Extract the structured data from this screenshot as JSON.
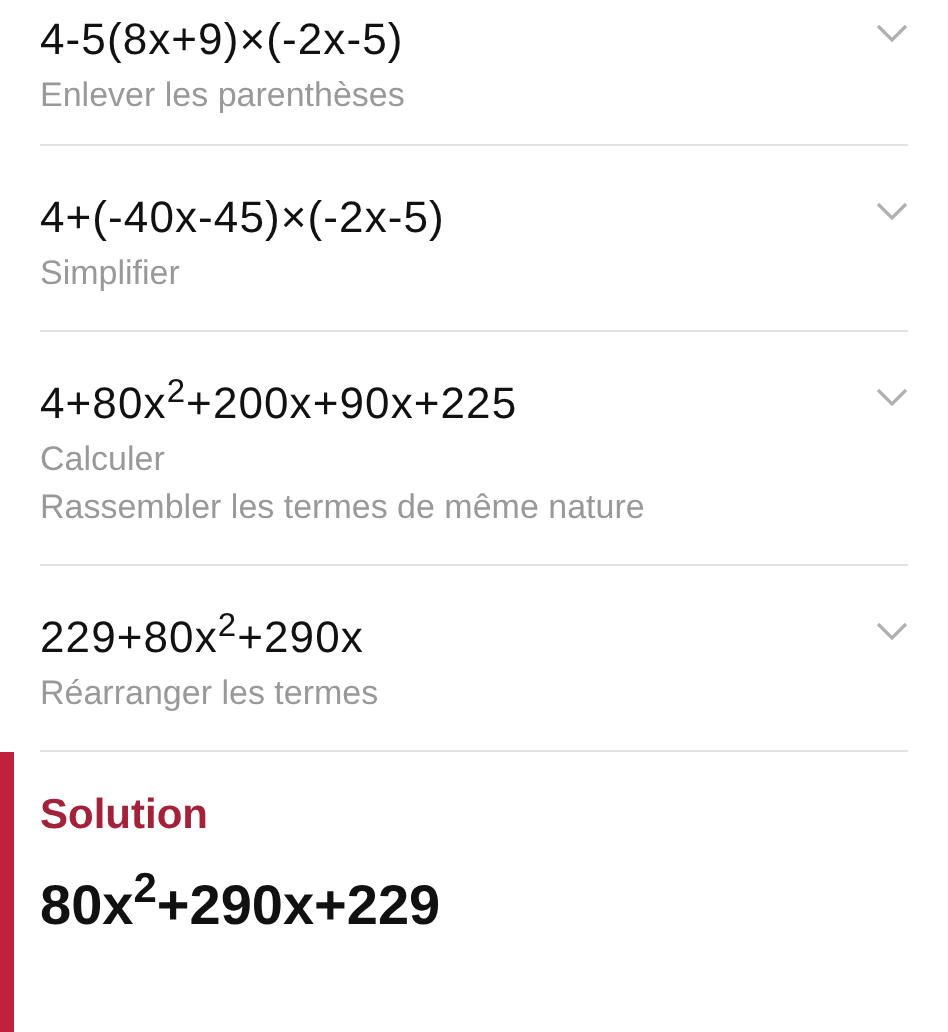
{
  "steps": [
    {
      "expression": "4-5(8x+9)×(-2x-5)",
      "descriptions": [
        "Enlever les parenthèses"
      ],
      "expanded": false
    },
    {
      "expression": "4+(-40x-45)×(-2x-5)",
      "descriptions": [
        "Simplifier"
      ],
      "expanded": false
    },
    {
      "expression": "4+80x$^{2}$+200x+90x+225",
      "descriptions": [
        "Calculer",
        "Rassembler les termes de même nature"
      ],
      "expanded": false
    },
    {
      "expression": "229+80x$^{2}$+290x",
      "descriptions": [
        "Réarranger les termes"
      ],
      "expanded": false
    }
  ],
  "solution": {
    "title": "Solution",
    "answer": "80x$^{2}$+290x+229"
  }
}
